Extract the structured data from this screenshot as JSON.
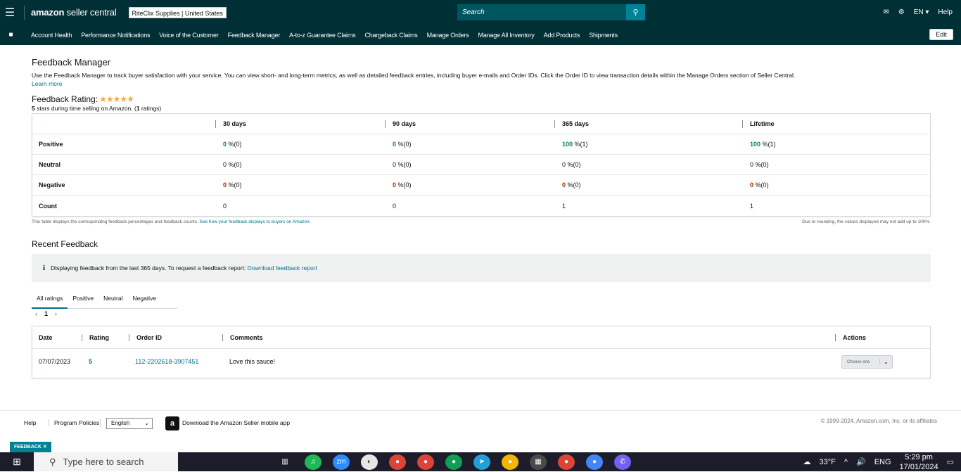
{
  "topbar": {
    "menu_icon": "hamburger-icon",
    "brand": "amazon",
    "brand_suffix": "seller central",
    "store": "RiteClix Supplies | United States",
    "search_placeholder": "Search",
    "language": "EN",
    "help": "Help"
  },
  "nav": {
    "items": [
      "Account Health",
      "Performance Notifications",
      "Voice of the Customer",
      "Feedback Manager",
      "A-to-z Guarantee Claims",
      "Chargeback Claims",
      "Manage Orders",
      "Manage All Inventory",
      "Add Products",
      "Shipments"
    ],
    "edit": "Edit"
  },
  "page": {
    "title": "Feedback Manager",
    "description": "Use the Feedback Manager to track buyer satisfaction with your service. You can view short- and long-term metrics, as well as detailed feedback entries, including buyer e-mails and Order IDs. Click the Order ID to view transaction details within the Manage Orders section of Seller Central.",
    "learn_more": "Learn more",
    "rating_label": "Feedback Rating:",
    "stars": "★★★★★",
    "rating_stars_value": "5",
    "rating_sub_a": " stars during time selling on Amazon. (",
    "rating_count": "1",
    "rating_sub_b": " ratings)"
  },
  "metrics": {
    "columns": [
      "30 days",
      "90 days",
      "365 days",
      "Lifetime"
    ],
    "rows": [
      {
        "label": "Positive",
        "values": [
          {
            "v": "0",
            "p": "%(0)"
          },
          {
            "v": "0",
            "p": "%(0)"
          },
          {
            "v": "100",
            "p": "%(1)"
          },
          {
            "v": "100",
            "p": "%(1)"
          }
        ]
      },
      {
        "label": "Neutral",
        "values": [
          {
            "v": "0",
            "p": "%(0)"
          },
          {
            "v": "0",
            "p": "%(0)"
          },
          {
            "v": "0",
            "p": "%(0)"
          },
          {
            "v": "0",
            "p": "%(0)"
          }
        ]
      },
      {
        "label": "Negative",
        "values": [
          {
            "v": "0",
            "p": "%(0)"
          },
          {
            "v": "0",
            "p": "%(0)"
          },
          {
            "v": "0",
            "p": "%(0)"
          },
          {
            "v": "0",
            "p": "%(0)"
          }
        ]
      },
      {
        "label": "Count",
        "values": [
          {
            "v": "0",
            "p": ""
          },
          {
            "v": "0",
            "p": ""
          },
          {
            "v": "1",
            "p": ""
          },
          {
            "v": "1",
            "p": ""
          }
        ]
      }
    ],
    "note_left": "This table displays the corresponding feedback percentages and feedback counts.",
    "note_link": "See how your feedback displays to buyers on Amazon.",
    "note_right": "Due to rounding, the values displayed may not add up to 100%."
  },
  "recent": {
    "title": "Recent Feedback",
    "info_text": "Displaying feedback from the last 365 days. To request a feedback report:",
    "info_link": "Download feedback report",
    "tabs": [
      "All ratings",
      "Positive",
      "Neutral",
      "Negative"
    ],
    "page": "1",
    "headers": [
      "Date",
      "Rating",
      "Order ID",
      "Comments",
      "Actions"
    ],
    "rows": [
      {
        "date": "07/07/2023",
        "rating": "5",
        "order_id": "112-2202618-3907451",
        "comment": "Love this sauce!",
        "action": "Choose one"
      }
    ]
  },
  "footer": {
    "help": "Help",
    "policies": "Program Policies",
    "language": "English",
    "app_text": "Download the Amazon Seller mobile app",
    "copyright": "© 1999-2024, Amazon.com, Inc. or its affiliates",
    "feedback_tab": "FEEDBACK"
  },
  "taskbar": {
    "search": "Type here to search",
    "temp": "33°F",
    "lang": "ENG",
    "time": "5:29 pm",
    "date": "17/01/2024"
  },
  "colors": {
    "header_bg": "#002f36",
    "link": "#007185",
    "positive": "#067d62",
    "negative": "#b12704"
  }
}
